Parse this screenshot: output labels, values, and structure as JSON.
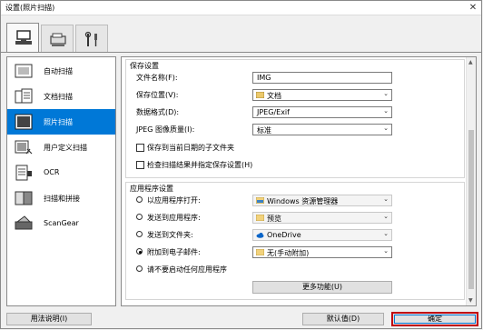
{
  "window": {
    "title": "设置(照片扫描)",
    "close_glyph": "✕"
  },
  "tabs": [
    {
      "icon": "scanner-from-computer-icon",
      "active": true
    },
    {
      "icon": "scanner-from-operation-panel-icon",
      "active": false
    },
    {
      "icon": "general-settings-tools-icon",
      "active": false
    }
  ],
  "sidebar": {
    "items": [
      {
        "label": "自动扫描",
        "icon": "auto-scan-icon",
        "selected": false
      },
      {
        "label": "文档扫描",
        "icon": "document-scan-icon",
        "selected": false
      },
      {
        "label": "照片扫描",
        "icon": "photo-scan-icon",
        "selected": true
      },
      {
        "label": "用户定义扫描",
        "icon": "custom-scan-icon",
        "selected": false
      },
      {
        "label": "OCR",
        "icon": "ocr-icon",
        "selected": false
      },
      {
        "label": "扫描和拼接",
        "icon": "scan-and-stitch-icon",
        "selected": false
      },
      {
        "label": "ScanGear",
        "icon": "scangear-icon",
        "selected": false
      }
    ]
  },
  "save_settings": {
    "title": "保存设置",
    "file_name_label": "文件名称(F):",
    "file_name_value": "IMG",
    "save_in_label": "保存位置(V):",
    "save_in_value": "文档",
    "data_format_label": "数据格式(D):",
    "data_format_value": "JPEG/Exif",
    "jpeg_quality_label": "JPEG 图像质量(I):",
    "jpeg_quality_value": "标准",
    "subfolder_label": "保存到当前日期的子文件夹",
    "check_results_label": "检查扫描结果并指定保存设置(H)"
  },
  "app_settings": {
    "title": "应用程序设置",
    "options": [
      {
        "label": "以应用程序打开:",
        "value": "Windows 资源管理器",
        "icon": "windows-explorer-icon",
        "selected": false,
        "enabled": false
      },
      {
        "label": "发送到应用程序:",
        "value": "预览",
        "icon": "folder-icon",
        "selected": false,
        "enabled": false
      },
      {
        "label": "发送到文件夹:",
        "value": "OneDrive",
        "icon": "onedrive-icon",
        "selected": false,
        "enabled": false
      },
      {
        "label": "附加到电子邮件:",
        "value": "无(手动附加)",
        "icon": "folder-icon",
        "selected": true,
        "enabled": true
      },
      {
        "label": "请不要启动任何应用程序",
        "selected": false
      }
    ],
    "more_functions_label": "更多功能(U)"
  },
  "footer": {
    "help_label": "用法说明(I)",
    "defaults_label": "默认值(D)",
    "ok_label": "确定"
  }
}
